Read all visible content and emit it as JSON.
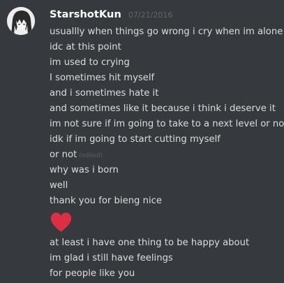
{
  "message": {
    "author": "StarshotKun",
    "timestamp": "07/21/2016",
    "avatar_icon": "anime-character-avatar",
    "colors": {
      "background": "#36393e",
      "username": "#ffffff",
      "text": "#dcddde",
      "heart": "#dd2e44"
    },
    "lines_before_heart": [
      "usuallly when things go wrong i cry when im alone",
      "idc at this point",
      "im used to crying",
      "I sometimes hit myself",
      "and i sometimes hate it",
      "and sometimes like it because i think i deserve it",
      "im not sure if im going to take to a next level or not",
      "idk if im going to start cutting myself"
    ],
    "edited_line": {
      "text": "or not",
      "edited_label": "(edited)"
    },
    "lines_after_edit": [
      "why was i born",
      "well",
      "thank you for bieng nice"
    ],
    "heart_emoji": "heart-emoji",
    "lines_after_heart": [
      "at least i have one thing to be happy about",
      "im glad i still have feelings",
      "for people like you"
    ]
  }
}
